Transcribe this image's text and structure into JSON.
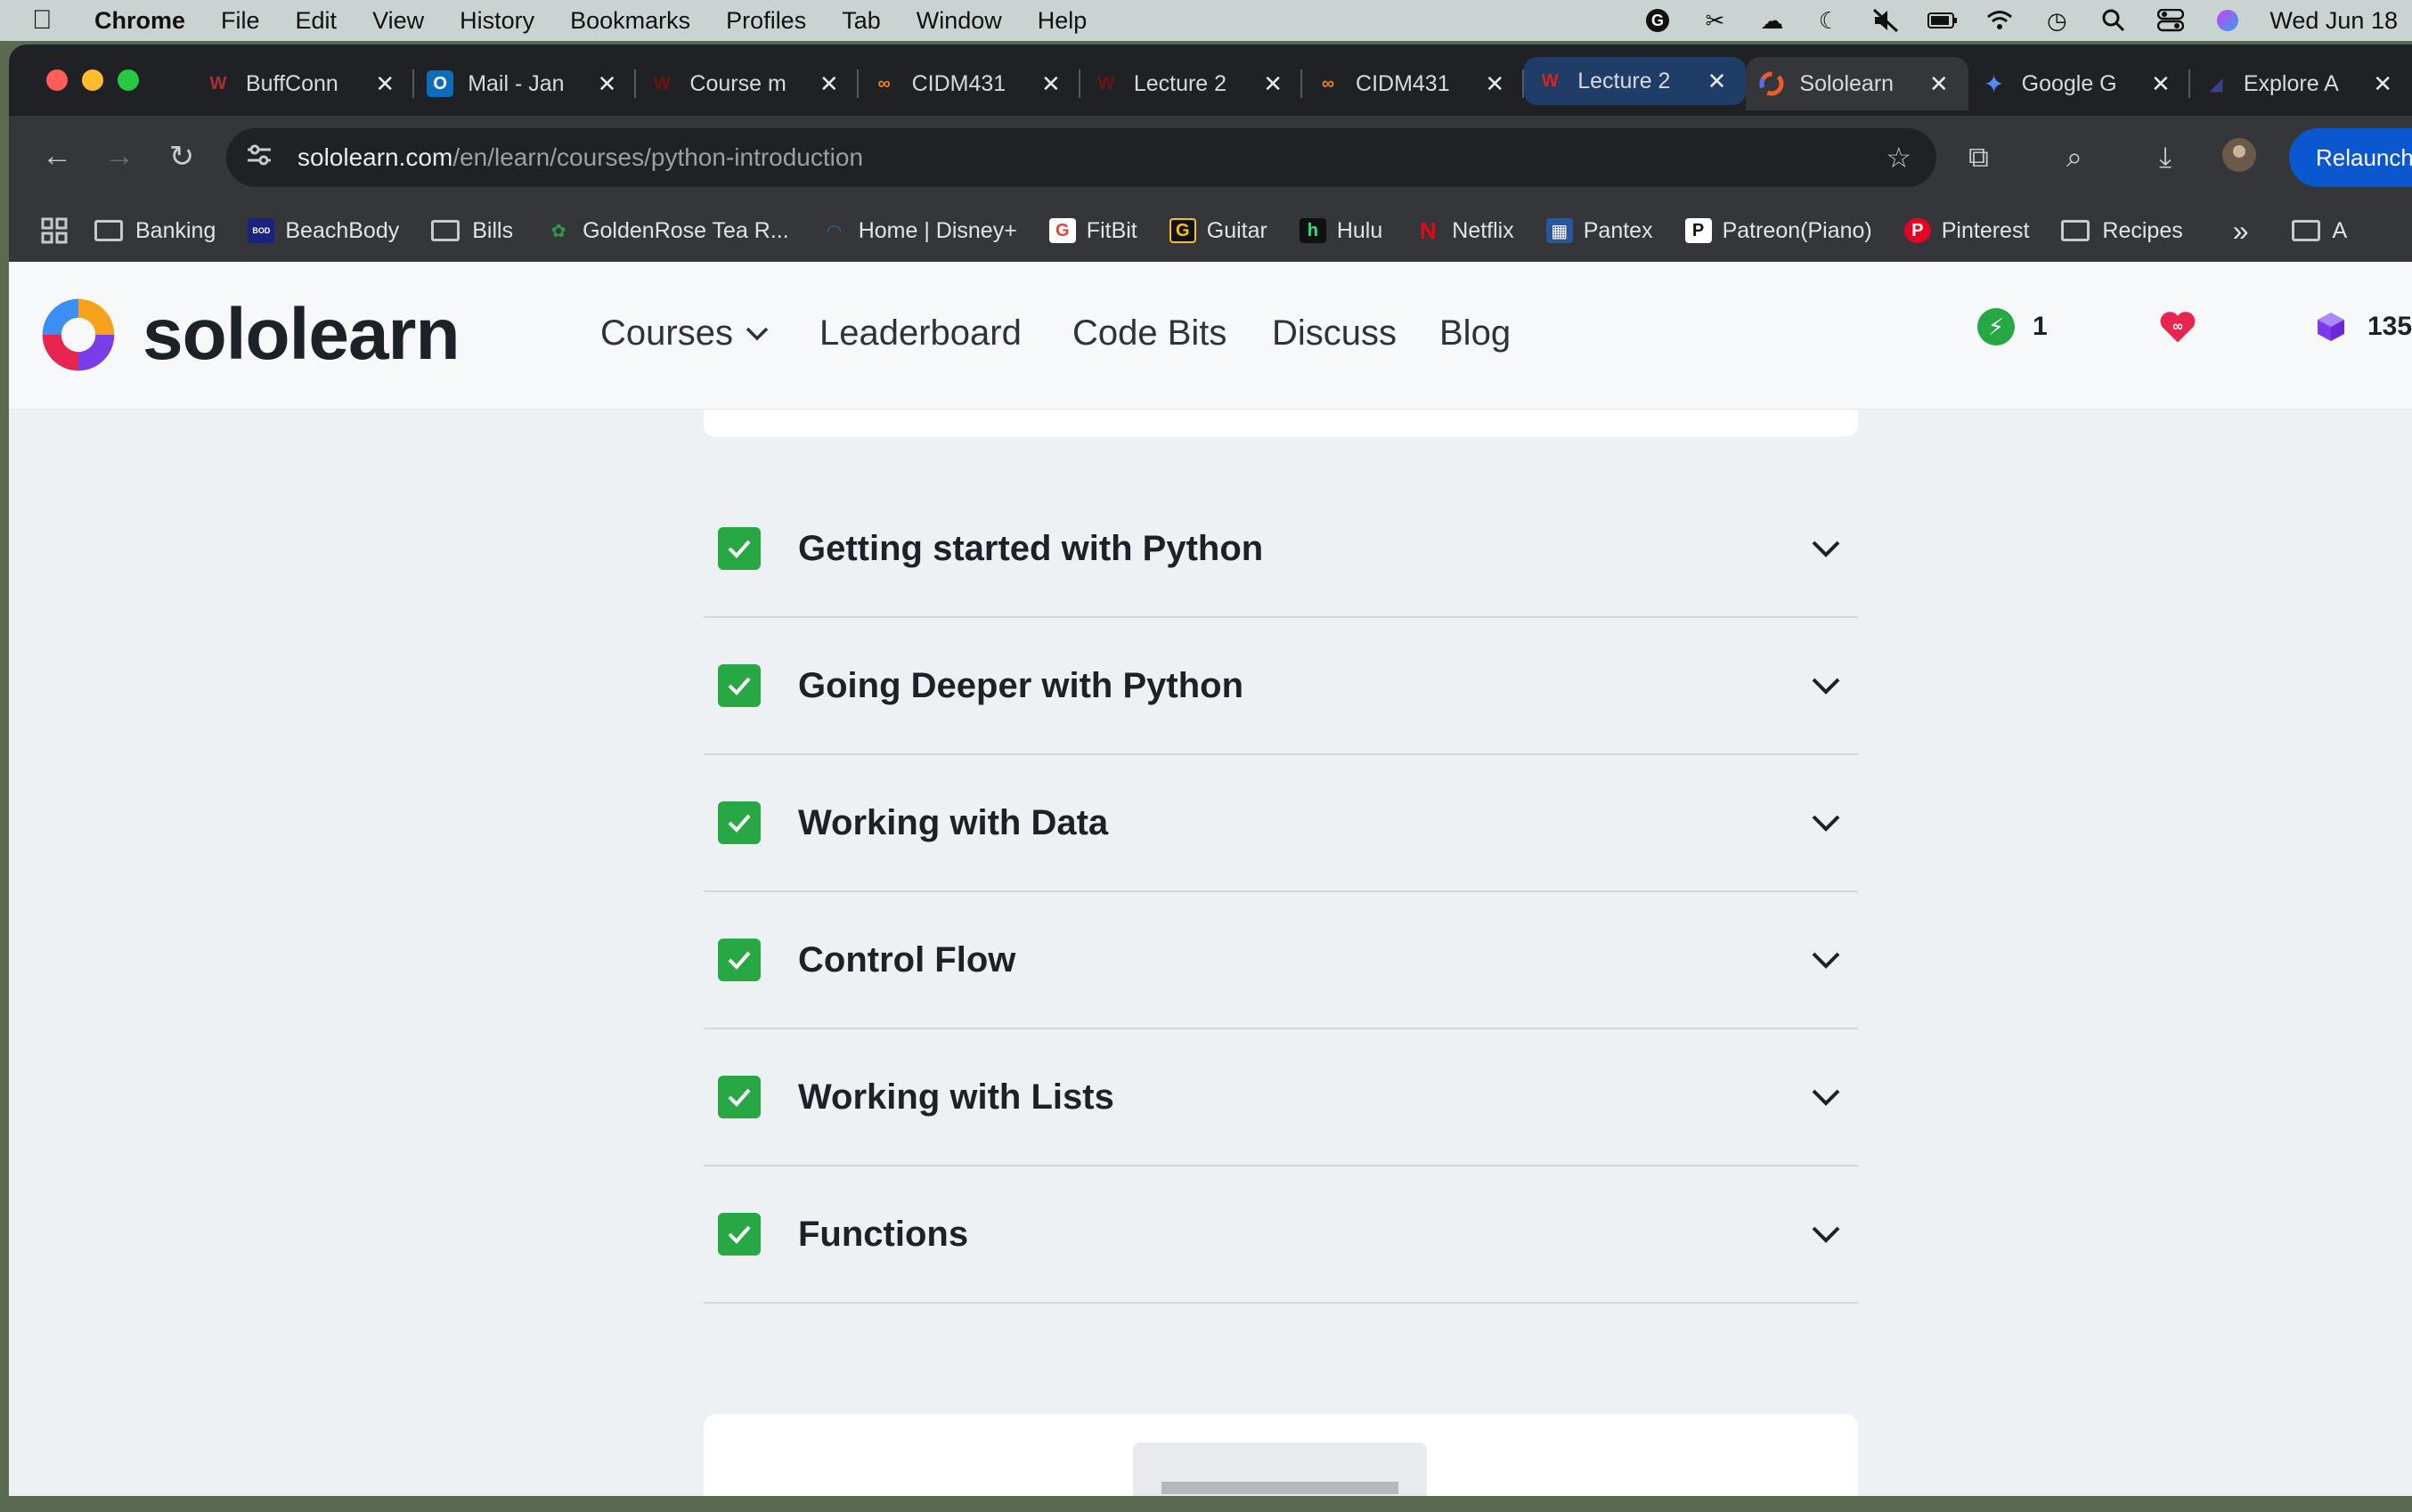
{
  "menubar": {
    "app": "Chrome",
    "items": [
      "File",
      "Edit",
      "View",
      "History",
      "Bookmarks",
      "Profiles",
      "Tab",
      "Window",
      "Help"
    ],
    "clock": "Wed Jun 18"
  },
  "tabs": [
    {
      "label": "BuffConn",
      "icon": "buff-icon",
      "color": "#7a1a1a"
    },
    {
      "label": "Mail - Jan",
      "icon": "outlook-icon",
      "color": "#0f6cbd"
    },
    {
      "label": "Course m",
      "icon": "course-icon",
      "color": "#6b1414"
    },
    {
      "label": "CIDM431",
      "icon": "infinity-icon",
      "color": "#f07b1e"
    },
    {
      "label": "Lecture 2",
      "icon": "lecture-icon",
      "color": "#6b1414"
    },
    {
      "label": "CIDM431",
      "icon": "infinity-icon",
      "color": "#f07b1e"
    },
    {
      "label": "Lecture 2",
      "icon": "lecture-icon",
      "color": "#b01c1c"
    },
    {
      "label": "Sololearn",
      "icon": "sololearn-icon",
      "color": "#f05a28"
    },
    {
      "label": "Google G",
      "icon": "gemini-icon",
      "color": "#4c8bf5"
    },
    {
      "label": "Explore A",
      "icon": "explore-icon",
      "color": "#3b3f8c"
    }
  ],
  "url": {
    "domain": "sololearn.com",
    "path": "/en/learn/courses/python-introduction"
  },
  "relaunch_label": "Relaunch to",
  "bookmarks": [
    {
      "label": "Banking",
      "type": "folder"
    },
    {
      "label": "BeachBody",
      "type": "site",
      "glyph": "BOD",
      "color": "#1a237e"
    },
    {
      "label": "Bills",
      "type": "folder"
    },
    {
      "label": "GoldenRose Tea R...",
      "type": "site",
      "glyph": "✿",
      "color": "#1e6b2e"
    },
    {
      "label": "Home | Disney+",
      "type": "site",
      "glyph": "◠",
      "color": "#1e4d6b"
    },
    {
      "label": "FitBit",
      "type": "site",
      "glyph": "G",
      "color": "#ffffff"
    },
    {
      "label": "Guitar",
      "type": "site",
      "glyph": "G",
      "color": "#111111"
    },
    {
      "label": "Hulu",
      "type": "site",
      "glyph": "h",
      "color": "#111111"
    },
    {
      "label": "Netflix",
      "type": "site",
      "glyph": "N",
      "color": "#e50914"
    },
    {
      "label": "Pantex",
      "type": "site",
      "glyph": "▦",
      "color": "#2a5599"
    },
    {
      "label": "Patreon(Piano)",
      "type": "site",
      "glyph": "P",
      "color": "#111111"
    },
    {
      "label": "Pinterest",
      "type": "site",
      "glyph": "P",
      "color": "#e60023"
    },
    {
      "label": "Recipes",
      "type": "folder"
    }
  ],
  "bookmarks_overflow": "»",
  "bookmarks_last": "A",
  "site": {
    "logo_text": "sololearn",
    "nav": [
      "Courses",
      "Leaderboard",
      "Code Bits",
      "Discuss",
      "Blog"
    ],
    "streak": "1",
    "bits": "135"
  },
  "modules": [
    {
      "title": "Getting started with Python",
      "completed": true
    },
    {
      "title": "Going Deeper with Python",
      "completed": true
    },
    {
      "title": "Working with Data",
      "completed": true
    },
    {
      "title": "Control Flow",
      "completed": true
    },
    {
      "title": "Working with Lists",
      "completed": true
    },
    {
      "title": "Functions",
      "completed": true
    }
  ],
  "colors": {
    "accent_green": "#28a745",
    "brand_dark": "#1d2128"
  }
}
